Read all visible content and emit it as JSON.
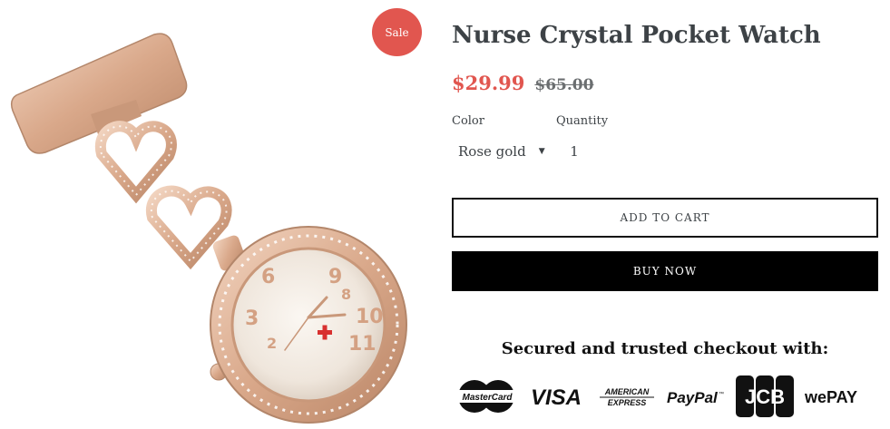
{
  "product": {
    "title": "Nurse Crystal Pocket Watch",
    "sale_badge": "Sale",
    "price_sale": "$29.99",
    "price_regular": "$65.00"
  },
  "options": {
    "color_label": "Color",
    "color_value": "Rose gold",
    "quantity_label": "Quantity",
    "quantity_value": "1"
  },
  "buttons": {
    "add_to_cart": "ADD TO CART",
    "buy_now": "BUY NOW"
  },
  "secure": {
    "heading": "Secured and trusted checkout with:",
    "logos": [
      {
        "name": "mastercard-logo",
        "text": "MasterCard"
      },
      {
        "name": "visa-logo",
        "text": "VISA"
      },
      {
        "name": "amex-logo",
        "text": "AMERICAN EXPRESS"
      },
      {
        "name": "paypal-logo",
        "text": "PayPal"
      },
      {
        "name": "jcb-logo",
        "text": "JCB"
      },
      {
        "name": "wepay-logo",
        "text": "wePAY"
      }
    ]
  },
  "colors": {
    "sale_red": "#e1564f",
    "text_dark": "#3d4246",
    "rose_gold": "#d9a88a"
  }
}
